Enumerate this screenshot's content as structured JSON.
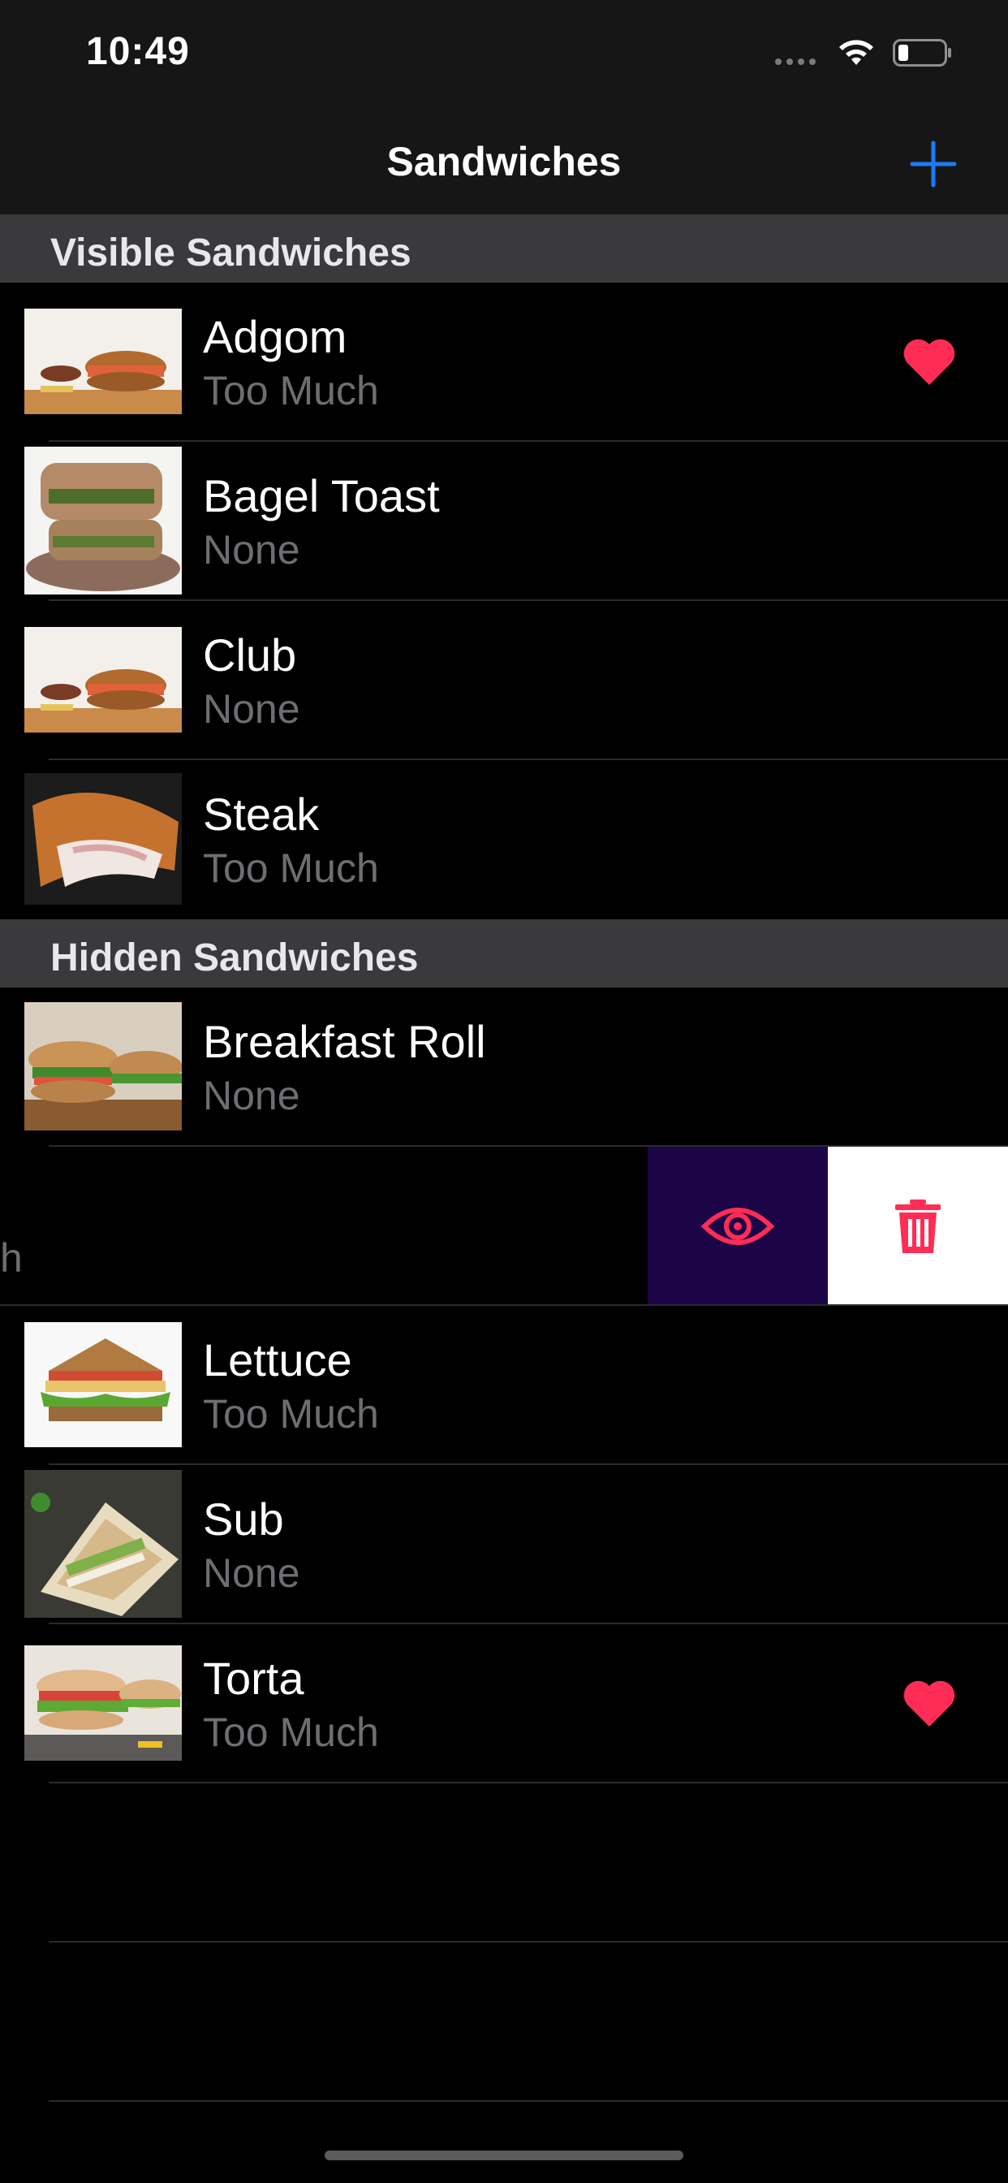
{
  "status_bar": {
    "time": "10:49",
    "icons": [
      "signal-dots-icon",
      "wifi-icon",
      "battery-icon"
    ]
  },
  "nav": {
    "title": "Sandwiches",
    "add_icon": "plus-icon",
    "accent_color": "#1a7cf5"
  },
  "sections": [
    {
      "title": "Visible Sandwiches",
      "items": [
        {
          "name": "Adgom",
          "subtitle": "Too Much",
          "favorite": true
        },
        {
          "name": "Bagel Toast",
          "subtitle": "None",
          "favorite": false
        },
        {
          "name": "Club",
          "subtitle": "None",
          "favorite": false
        },
        {
          "name": "Steak",
          "subtitle": "Too Much",
          "favorite": false
        }
      ]
    },
    {
      "title": "Hidden Sandwiches",
      "items": [
        {
          "name": "Breakfast Roll",
          "subtitle": "None",
          "favorite": false
        },
        {
          "partial_text": "h",
          "swiped": true,
          "actions": [
            "eye-icon",
            "trash-icon"
          ]
        },
        {
          "name": "Lettuce",
          "subtitle": "Too Much",
          "favorite": false
        },
        {
          "name": "Sub",
          "subtitle": "None",
          "favorite": false
        },
        {
          "name": "Torta",
          "subtitle": "Too Much",
          "favorite": true
        }
      ]
    }
  ],
  "colors": {
    "heart": "#ff2d55",
    "reveal_action_bg": "#1b0547",
    "delete_action_bg": "#ffffff",
    "section_header_bg": "#3a3a3c",
    "subtitle": "#6e6e72"
  }
}
